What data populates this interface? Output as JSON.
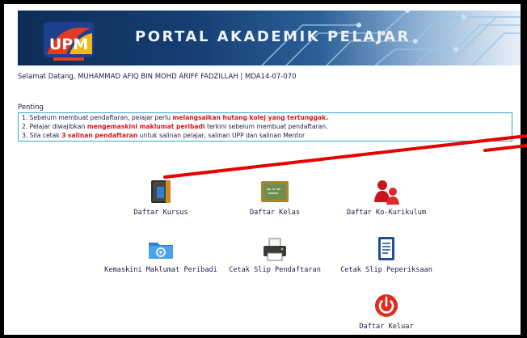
{
  "header": {
    "logo_text": "UPM",
    "title": "PORTAL AKADEMIK PELAJAR"
  },
  "welcome": {
    "text": "Selamat Datang, MUHAMMAD AFIQ BIN MOHD ARIFF FADZILLAH | MDA14-07-070"
  },
  "notice": {
    "heading": "Penting",
    "lines": [
      {
        "pre": "1.   Sebelum membuat pendaftaran, pelajar perlu ",
        "highlight": "melangsaikan hutang kolej yang tertunggak.",
        "post": ""
      },
      {
        "pre": "2.   Pelajar diwajibkan ",
        "highlight": "mengemaskini maklumat peribadi",
        "post": " terkini sebelum membuat pendaftaran."
      },
      {
        "pre": "3.   Sila cetak ",
        "highlight": "3 salinan pendaftaran",
        "post": " untuk salinan pelajar, salinan UPP dan salinan Mentor"
      }
    ]
  },
  "menu": {
    "daftar_kursus": {
      "label": "Daftar Kursus",
      "icon": "book-icon"
    },
    "daftar_kelas": {
      "label": "Daftar Kelas",
      "icon": "chalkboard-icon"
    },
    "daftar_kokurikulum": {
      "label": "Daftar Ko-Kurikulum",
      "icon": "people-icon"
    },
    "kemaskini": {
      "label": "Kemaskini Maklumat Peribadi",
      "icon": "folder-icon"
    },
    "cetak_slip_pendaftaran": {
      "label": "Cetak Slip Pendaftaran",
      "icon": "printer-icon"
    },
    "cetak_slip_peperiksaan": {
      "label": "Cetak Slip Peperiksaan",
      "icon": "document-icon"
    },
    "daftar_keluar": {
      "label": "Daftar Keluar",
      "icon": "power-icon"
    }
  },
  "colors": {
    "banner_dark": "#0d2d57",
    "highlight_red": "#d8141c",
    "notice_border": "#2fa8d0",
    "annotation_red": "#e60000"
  }
}
